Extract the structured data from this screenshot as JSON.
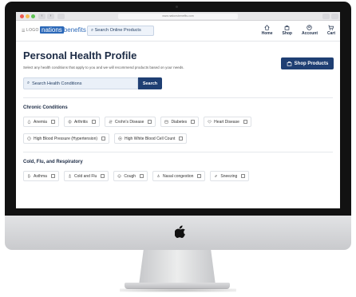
{
  "browser": {
    "url": "www.nationsbenefits.com"
  },
  "header": {
    "logo_text": "LOGO",
    "brand_highlight": "nations",
    "brand_rest": "benefits",
    "search_placeholder": "Search Online Products",
    "nav": [
      {
        "label": "Home",
        "icon": "home-icon"
      },
      {
        "label": "Shop",
        "icon": "bag-icon"
      },
      {
        "label": "Account",
        "icon": "account-icon"
      },
      {
        "label": "Cart",
        "icon": "cart-icon"
      }
    ]
  },
  "main": {
    "title": "Personal Health Profile",
    "subtitle": "Select any health conditions that apply to you and we will recommend products based on your needs.",
    "shop_button": "Shop Products",
    "condition_search_placeholder": "Search Health Conditions",
    "search_button": "Search",
    "sections": [
      {
        "title": "Chronic Conditions",
        "rows": [
          [
            "Anemia",
            "Arthritis",
            "Crohn's Disease",
            "Diabetes",
            "Heart Disease"
          ],
          [
            "High Blood Pressure (Hypertension)",
            "High White Blood Cell Count"
          ]
        ]
      },
      {
        "title": "Cold, Flu, and Respiratory",
        "rows": [
          [
            "Asthma",
            "Cold and Flu",
            "Cough",
            "Nasal congestion",
            "Sneezing"
          ]
        ]
      }
    ]
  },
  "colors": {
    "primary": "#1f3f73",
    "brand": "#2b68b8",
    "input_bg": "#eaf0f8"
  }
}
